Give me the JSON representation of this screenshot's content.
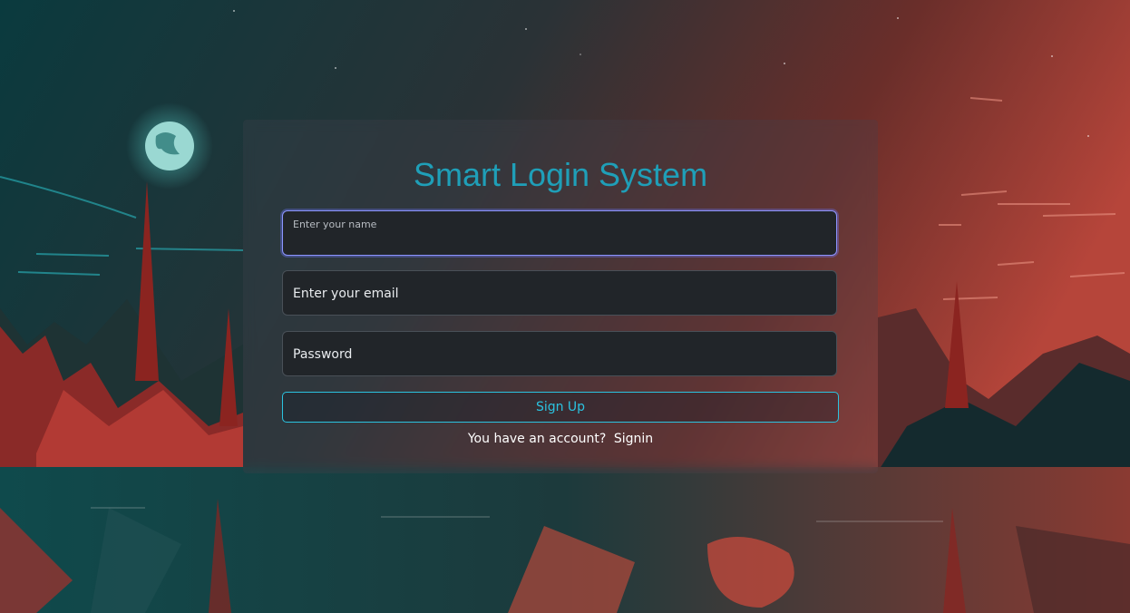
{
  "title": "Smart Login System",
  "fields": {
    "name": {
      "label": "Enter your name",
      "value": ""
    },
    "email": {
      "label": "Enter your email",
      "value": ""
    },
    "password": {
      "label": "Password",
      "value": ""
    }
  },
  "signup_button": "Sign Up",
  "switch": {
    "prompt": "You have an account?",
    "link": "Signin"
  },
  "colors": {
    "accent": "#1f9fb8",
    "button_border": "#2bc3e0",
    "input_bg": "#212529",
    "focus_border": "#8c95ff"
  }
}
